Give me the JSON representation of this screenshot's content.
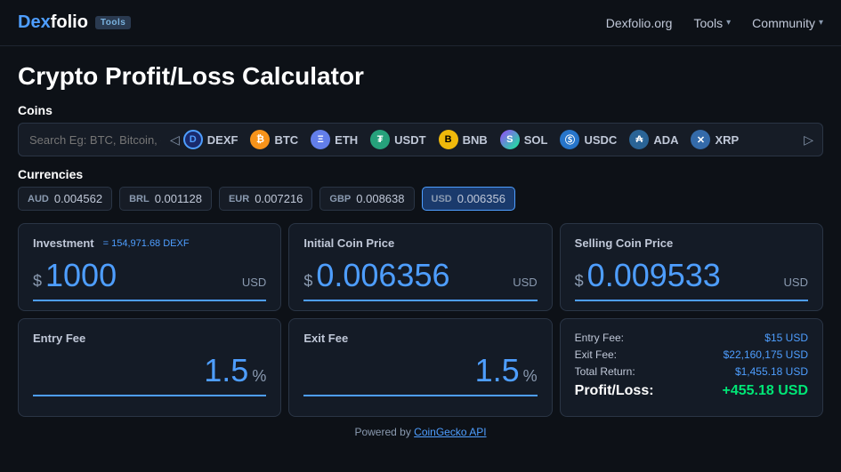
{
  "navbar": {
    "logo": "Dexfolio",
    "logo_accent": "Dex",
    "logo_rest": "folio",
    "badge": "Tools",
    "links": [
      {
        "label": "Dexfolio.org",
        "hasChevron": false
      },
      {
        "label": "Tools",
        "hasChevron": true
      },
      {
        "label": "Community",
        "hasChevron": true
      }
    ]
  },
  "page": {
    "title": "Crypto Profit/Loss Calculator"
  },
  "coins_section": {
    "label": "Coins",
    "search_placeholder": "Search Eg: BTC, Bitcoin, etc.",
    "coins": [
      {
        "symbol": "DEXF",
        "class": "ci-dexf",
        "letter": "D"
      },
      {
        "symbol": "BTC",
        "class": "ci-btc",
        "letter": "₿"
      },
      {
        "symbol": "ETH",
        "class": "ci-eth",
        "letter": "Ξ"
      },
      {
        "symbol": "USDT",
        "class": "ci-usdt",
        "letter": "₮"
      },
      {
        "symbol": "BNB",
        "class": "ci-bnb",
        "letter": "B"
      },
      {
        "symbol": "SOL",
        "class": "ci-sol",
        "letter": "S"
      },
      {
        "symbol": "USDC",
        "class": "ci-usdc",
        "letter": "Ⓢ"
      },
      {
        "symbol": "ADA",
        "class": "ci-ada",
        "letter": "₳"
      },
      {
        "symbol": "XRP",
        "class": "ci-xrp",
        "letter": "✕"
      }
    ]
  },
  "currencies_section": {
    "label": "Currencies",
    "currencies": [
      {
        "code": "AUD",
        "value": "0.004562",
        "active": false
      },
      {
        "code": "BRL",
        "value": "0.001128",
        "active": false
      },
      {
        "code": "EUR",
        "value": "0.007216",
        "active": false
      },
      {
        "code": "GBP",
        "value": "0.008638",
        "active": false
      },
      {
        "code": "USD",
        "value": "0.006356",
        "active": true
      }
    ]
  },
  "calculator": {
    "investment": {
      "label": "Investment",
      "equiv": "= 154,971.68 DEXF",
      "dollar": "$",
      "value": "1000",
      "currency": "USD"
    },
    "initial_price": {
      "label": "Initial Coin Price",
      "dollar": "$",
      "value": "0.006356",
      "currency": "USD"
    },
    "selling_price": {
      "label": "Selling Coin Price",
      "dollar": "$",
      "value": "0.009533",
      "currency": "USD"
    },
    "entry_fee": {
      "label": "Entry Fee",
      "value": "1.5",
      "suffix": "%"
    },
    "exit_fee": {
      "label": "Exit Fee",
      "value": "1.5",
      "suffix": "%"
    },
    "result": {
      "entry_fee_label": "Entry Fee:",
      "entry_fee_value": "$15 USD",
      "exit_fee_label": "Exit Fee:",
      "exit_fee_value": "$22,160,175 USD",
      "total_return_label": "Total Return:",
      "total_return_value": "$1,455.18 USD",
      "profit_loss_label": "Profit/Loss:",
      "profit_loss_value": "+455.18 USD"
    }
  },
  "footer": {
    "text": "Powered by ",
    "link_text": "CoinGecko API"
  }
}
